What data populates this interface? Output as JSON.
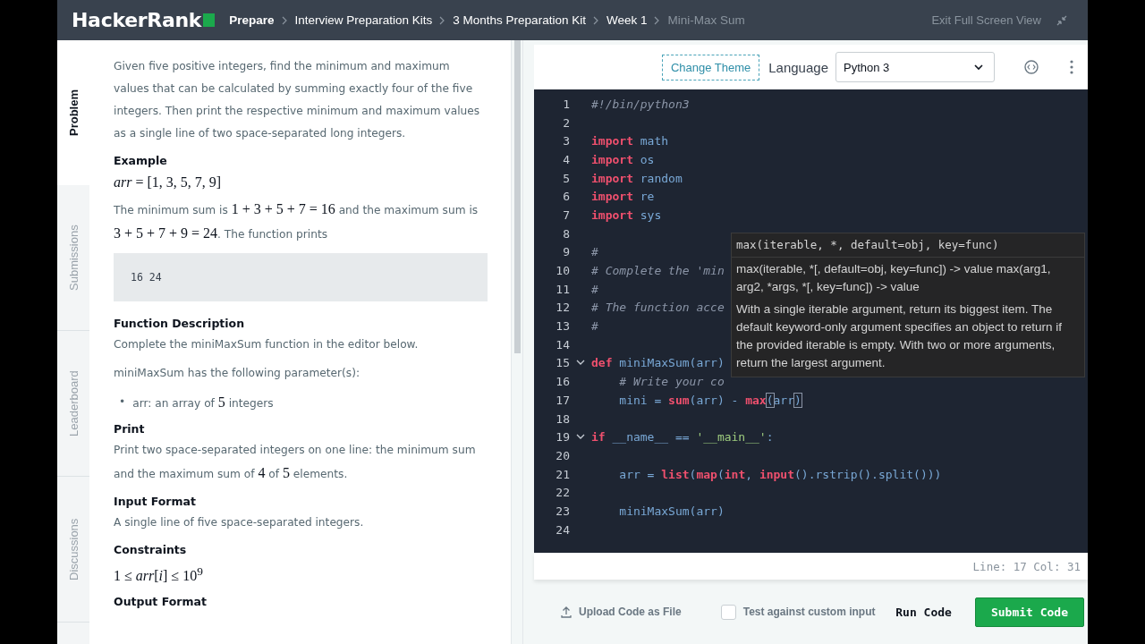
{
  "header": {
    "logo": "HackerRank",
    "breadcrumbs": [
      {
        "label": "Prepare",
        "kind": "root"
      },
      {
        "label": "Interview Preparation Kits",
        "kind": "link"
      },
      {
        "label": "3 Months Preparation Kit",
        "kind": "link"
      },
      {
        "label": "Week 1",
        "kind": "link"
      },
      {
        "label": "Mini-Max Sum",
        "kind": "current"
      }
    ],
    "exit_label": "Exit Full Screen View"
  },
  "side_tabs": [
    {
      "label": "Problem",
      "selected": true
    },
    {
      "label": "Submissions",
      "selected": false
    },
    {
      "label": "Leaderboard",
      "selected": false
    },
    {
      "label": "Discussions",
      "selected": false
    }
  ],
  "problem": [
    {
      "kind": "paragraph",
      "segments": [
        {
          "kind": "text",
          "text": "Given five positive integers, find the minimum and maximum values that can be calculated by summing exactly four of the five integers. Then print the respective minimum and maximum values as a single line of two space-separated long integers."
        }
      ]
    },
    {
      "kind": "heading",
      "text": "Example"
    },
    {
      "kind": "math",
      "text": "*arr* = [1, 3, 5, 7, 9]"
    },
    {
      "kind": "paragraph",
      "segments": [
        {
          "kind": "text",
          "text": "The minimum sum is "
        },
        {
          "kind": "math",
          "text": "1 + 3 + 5 + 7 = 16"
        },
        {
          "kind": "text",
          "text": " and the maximum sum is "
        },
        {
          "kind": "math",
          "text": "3 + 5 + 7 + 9 = 24"
        },
        {
          "kind": "text",
          "text": ". The function prints"
        }
      ]
    },
    {
      "kind": "code",
      "text": "16 24"
    },
    {
      "kind": "heading",
      "text": "Function Description"
    },
    {
      "kind": "paragraph",
      "segments": [
        {
          "kind": "text",
          "text": "Complete the miniMaxSum function in the editor below."
        }
      ]
    },
    {
      "kind": "paragraph",
      "segments": [
        {
          "kind": "text",
          "text": "miniMaxSum has the following parameter(s):"
        }
      ]
    },
    {
      "kind": "bullet",
      "marker": "•",
      "segments": [
        {
          "kind": "text",
          "text": "arr: an array of "
        },
        {
          "kind": "math",
          "text": "5"
        },
        {
          "kind": "text",
          "text": " integers"
        }
      ]
    },
    {
      "kind": "heading",
      "text": "Print"
    },
    {
      "kind": "paragraph",
      "segments": [
        {
          "kind": "text",
          "text": "Print two space-separated integers on one line: the minimum sum and the maximum sum of "
        },
        {
          "kind": "math",
          "text": "4"
        },
        {
          "kind": "text",
          "text": " of "
        },
        {
          "kind": "math",
          "text": "5"
        },
        {
          "kind": "text",
          "text": " elements."
        }
      ]
    },
    {
      "kind": "heading",
      "text": "Input Format"
    },
    {
      "kind": "paragraph",
      "segments": [
        {
          "kind": "text",
          "text": "A single line of five space-separated integers."
        }
      ]
    },
    {
      "kind": "heading",
      "text": "Constraints"
    },
    {
      "kind": "math",
      "text": "1 ≤ *arr*[*i*] ≤ 10$^{9}$"
    },
    {
      "kind": "heading",
      "text": "Output Format"
    }
  ],
  "editor": {
    "change_theme": "Change Theme",
    "language_label": "Language",
    "language": "Python 3",
    "lines": [
      {
        "number": "1",
        "fold": false,
        "tokens": [
          {
            "kind": "comment",
            "text": "#!/bin/python3"
          }
        ]
      },
      {
        "number": "2",
        "fold": false
      },
      {
        "number": "3",
        "fold": false,
        "tokens": [
          {
            "kind": "keyword",
            "text": "import"
          },
          {
            "kind": "name",
            "text": " math"
          }
        ]
      },
      {
        "number": "4",
        "fold": false,
        "tokens": [
          {
            "kind": "keyword",
            "text": "import"
          },
          {
            "kind": "name",
            "text": " os"
          }
        ]
      },
      {
        "number": "5",
        "fold": false,
        "tokens": [
          {
            "kind": "keyword",
            "text": "import"
          },
          {
            "kind": "name",
            "text": " random"
          }
        ]
      },
      {
        "number": "6",
        "fold": false,
        "tokens": [
          {
            "kind": "keyword",
            "text": "import"
          },
          {
            "kind": "name",
            "text": " re"
          }
        ]
      },
      {
        "number": "7",
        "fold": false,
        "tokens": [
          {
            "kind": "keyword",
            "text": "import"
          },
          {
            "kind": "name",
            "text": " sys"
          }
        ]
      },
      {
        "number": "8",
        "fold": false
      },
      {
        "number": "9",
        "fold": false,
        "tokens": [
          {
            "kind": "comment",
            "text": "#"
          }
        ]
      },
      {
        "number": "10",
        "fold": false,
        "tokens": [
          {
            "kind": "comment",
            "text": "# Complete the 'min"
          }
        ]
      },
      {
        "number": "11",
        "fold": false,
        "tokens": [
          {
            "kind": "comment",
            "text": "#"
          }
        ]
      },
      {
        "number": "12",
        "fold": false,
        "tokens": [
          {
            "kind": "comment",
            "text": "# The function acce"
          }
        ]
      },
      {
        "number": "13",
        "fold": false,
        "tokens": [
          {
            "kind": "comment",
            "text": "#"
          }
        ]
      },
      {
        "number": "14",
        "fold": false
      },
      {
        "number": "15",
        "fold": true,
        "tokens": [
          {
            "kind": "keyword",
            "text": "def"
          },
          {
            "kind": "name",
            "text": " miniMaxSum(arr)"
          }
        ]
      },
      {
        "number": "16",
        "fold": false,
        "tokens": [
          {
            "kind": "comment",
            "text": "    # Write your co"
          }
        ]
      },
      {
        "number": "17",
        "fold": false,
        "tokens": [
          {
            "kind": "name",
            "text": "    mini = "
          },
          {
            "kind": "keyword",
            "text": "sum"
          },
          {
            "kind": "name",
            "text": "(arr) - "
          },
          {
            "kind": "keyword",
            "text": "max"
          },
          {
            "kind": "match",
            "text": "("
          },
          {
            "kind": "name",
            "text": "arr"
          },
          {
            "kind": "match",
            "text": ")"
          }
        ]
      },
      {
        "number": "18",
        "fold": false
      },
      {
        "number": "19",
        "fold": true,
        "tokens": [
          {
            "kind": "keyword",
            "text": "if"
          },
          {
            "kind": "name",
            "text": " __name__ == "
          },
          {
            "kind": "string",
            "text": "'__main__'"
          },
          {
            "kind": "name",
            "text": ":"
          }
        ]
      },
      {
        "number": "20",
        "fold": false
      },
      {
        "number": "21",
        "fold": false,
        "tokens": [
          {
            "kind": "name",
            "text": "    arr = "
          },
          {
            "kind": "keyword",
            "text": "list"
          },
          {
            "kind": "name",
            "text": "("
          },
          {
            "kind": "keyword",
            "text": "map"
          },
          {
            "kind": "name",
            "text": "("
          },
          {
            "kind": "keyword",
            "text": "int"
          },
          {
            "kind": "name",
            "text": ", "
          },
          {
            "kind": "keyword",
            "text": "input"
          },
          {
            "kind": "name",
            "text": "().rstrip().split()))"
          }
        ]
      },
      {
        "number": "22",
        "fold": false
      },
      {
        "number": "23",
        "fold": false,
        "tokens": [
          {
            "kind": "name",
            "text": "    miniMaxSum(arr)"
          }
        ]
      },
      {
        "number": "24",
        "fold": false
      }
    ],
    "tooltip": {
      "signature": "max(iterable, *, default=obj, key=func)",
      "usage": "max(iterable, *[, default=obj, key=func]) -> value max(arg1, arg2, *args, *[, key=func]) -> value",
      "description": "With a single iterable argument, return its biggest item. The default keyword-only argument specifies an object to return if the provided iterable is empty. With two or more arguments, return the largest argument."
    },
    "status": "Line: 17 Col: 31"
  },
  "bottom_bar": {
    "upload": "Upload Code as File",
    "custom_input": {
      "label": "Test against custom input",
      "checked": false
    },
    "run": "Run Code",
    "submit": "Submit Code"
  }
}
